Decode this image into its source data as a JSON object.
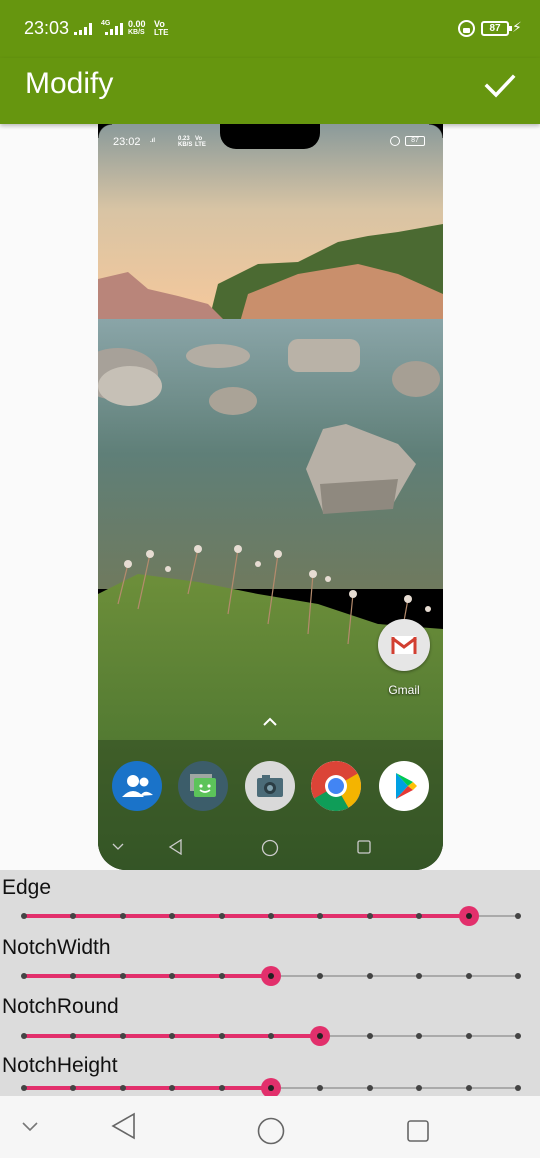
{
  "status_bar": {
    "time": "23:03",
    "net1_top": "4G",
    "net1_rate": "0.00",
    "net1_unit": "KB/S",
    "volte_top": "Vo",
    "volte_bottom": "LTE",
    "battery": "87"
  },
  "app_bar": {
    "title": "Modify",
    "confirm_icon": "check-icon",
    "background": "#66960f"
  },
  "preview": {
    "status_time": "23:02",
    "status_rate": "0.23",
    "status_unit": "KB/S",
    "status_volte": "Vo",
    "status_lte": "LTE",
    "battery": "87",
    "shortcut_label": "Gmail",
    "dock_icons": [
      "contacts-icon",
      "messaging-icon",
      "camera-icon",
      "chrome-icon",
      "play-store-icon"
    ]
  },
  "sliders": {
    "edge": {
      "label": "Edge",
      "value": 0.9
    },
    "notch_width": {
      "label": "NotchWidth",
      "value": 0.5
    },
    "notch_round": {
      "label": "NotchRound",
      "value": 0.6
    },
    "notch_height": {
      "label": "NotchHeight",
      "value": 0.5
    },
    "steps": 10,
    "accent": "#e2306c"
  },
  "nav_icons": [
    "collapse-icon",
    "back-icon",
    "home-icon",
    "recents-icon"
  ]
}
